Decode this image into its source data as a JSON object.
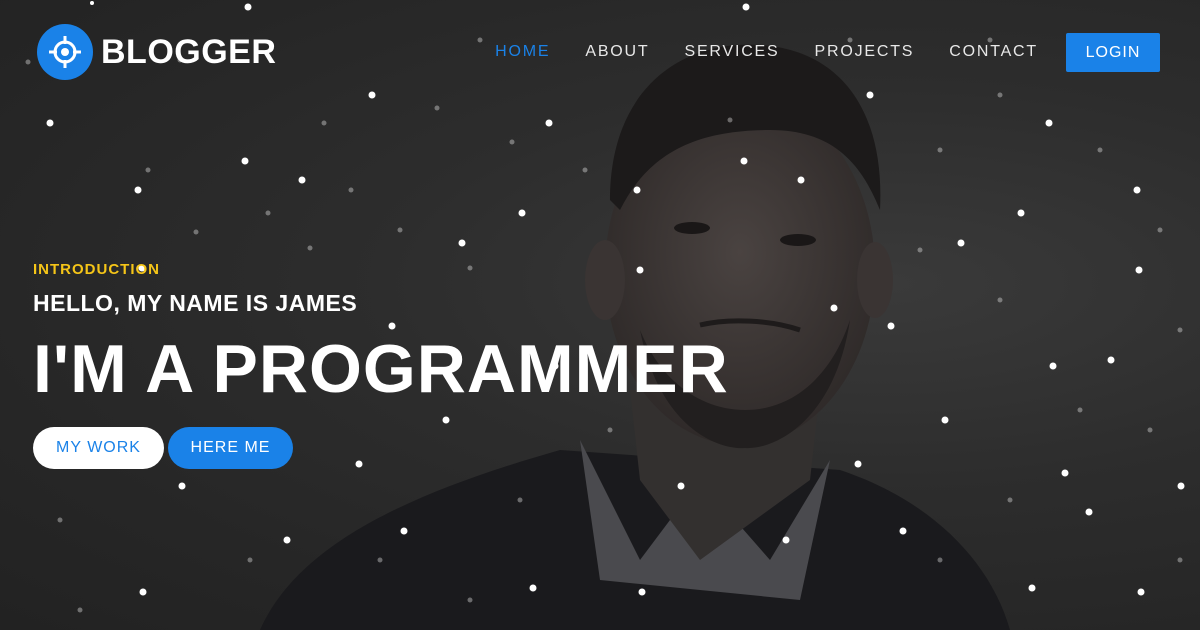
{
  "brand": {
    "name": "BLOGGER",
    "icon": "crosshair-icon",
    "accent": "#1a82e8"
  },
  "nav": {
    "items": [
      {
        "label": "HOME",
        "active": true
      },
      {
        "label": "ABOUT",
        "active": false
      },
      {
        "label": "SERVICES",
        "active": false
      },
      {
        "label": "PROJECTS",
        "active": false
      },
      {
        "label": "CONTACT",
        "active": false
      }
    ],
    "login_label": "LOGIN"
  },
  "hero": {
    "eyebrow": "INTRODUCTION",
    "greeting": "HELLO, MY NAME IS JAMES",
    "headline": "I'M A PROGRAMMER",
    "primary_button": "MY WORK",
    "secondary_button": "HERE ME",
    "eyebrow_color": "#f5c518"
  }
}
